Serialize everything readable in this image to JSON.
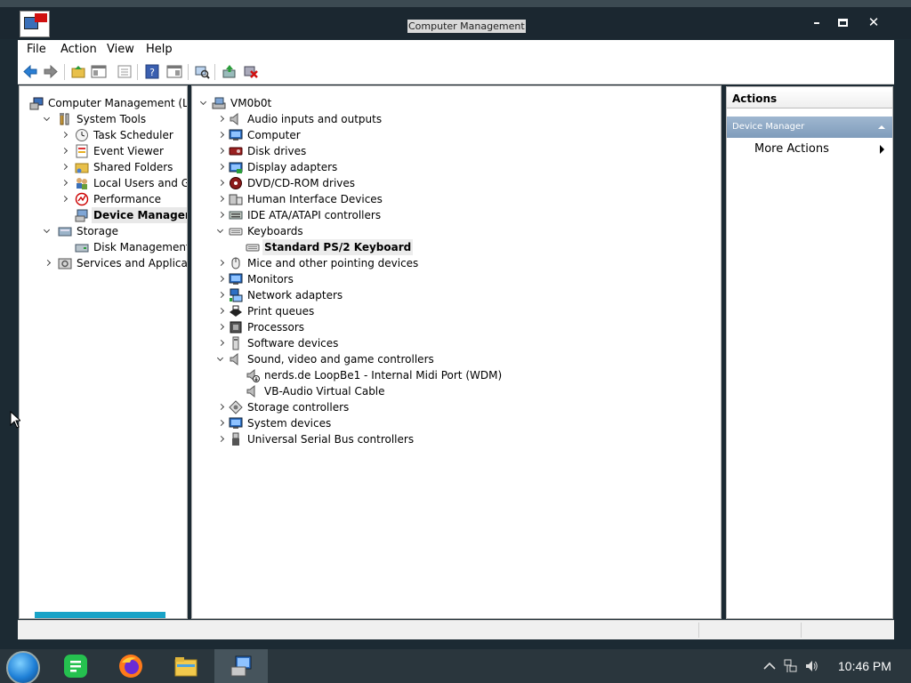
{
  "window": {
    "title": "Computer Management"
  },
  "menu": [
    "File",
    "Action",
    "View",
    "Help"
  ],
  "tree": [
    {
      "label": "Computer Management (Local)",
      "icon": "computer-management-icon",
      "exp": ""
    },
    {
      "label": "System Tools",
      "icon": "tools-icon",
      "exp": "o"
    },
    {
      "label": "Task Scheduler",
      "icon": "clock-icon",
      "exp": "c"
    },
    {
      "label": "Event Viewer",
      "icon": "event-viewer-icon",
      "exp": "c"
    },
    {
      "label": "Shared Folders",
      "icon": "shared-folder-icon",
      "exp": "c"
    },
    {
      "label": "Local Users and Groups",
      "icon": "users-icon",
      "exp": "c"
    },
    {
      "label": "Performance",
      "icon": "performance-icon",
      "exp": "c"
    },
    {
      "label": "Device Manager",
      "icon": "device-manager-icon",
      "exp": "",
      "selected": true
    },
    {
      "label": "Storage",
      "icon": "storage-icon",
      "exp": "o"
    },
    {
      "label": "Disk Management",
      "icon": "disk-management-icon",
      "exp": ""
    },
    {
      "label": "Services and Applications",
      "icon": "services-icon",
      "exp": "c"
    }
  ],
  "devices": [
    {
      "label": "VM0b0t",
      "icon": "computer-icon",
      "exp": "o"
    },
    {
      "label": "Audio inputs and outputs",
      "icon": "speaker-icon",
      "exp": "c"
    },
    {
      "label": "Computer",
      "icon": "monitor-icon",
      "exp": "c"
    },
    {
      "label": "Disk drives",
      "icon": "disk-drive-icon",
      "exp": "c"
    },
    {
      "label": "Display adapters",
      "icon": "display-adapter-icon",
      "exp": "c"
    },
    {
      "label": "DVD/CD-ROM drives",
      "icon": "dvd-icon",
      "exp": "c"
    },
    {
      "label": "Human Interface Devices",
      "icon": "hid-icon",
      "exp": "c"
    },
    {
      "label": "IDE ATA/ATAPI controllers",
      "icon": "ide-icon",
      "exp": "c"
    },
    {
      "label": "Keyboards",
      "icon": "keyboard-icon",
      "exp": "o"
    },
    {
      "label": "Standard PS/2 Keyboard",
      "icon": "keyboard-icon",
      "exp": "",
      "child": true,
      "selected": true
    },
    {
      "label": "Mice and other pointing devices",
      "icon": "mouse-icon",
      "exp": "c"
    },
    {
      "label": "Monitors",
      "icon": "monitor-icon",
      "exp": "c"
    },
    {
      "label": "Network adapters",
      "icon": "network-icon",
      "exp": "c"
    },
    {
      "label": "Print queues",
      "icon": "printer-icon",
      "exp": "c"
    },
    {
      "label": "Processors",
      "icon": "processor-icon",
      "exp": "c"
    },
    {
      "label": "Software devices",
      "icon": "software-device-icon",
      "exp": "c"
    },
    {
      "label": "Sound, video and game controllers",
      "icon": "speaker-icon",
      "exp": "o"
    },
    {
      "label": "nerds.de LoopBe1 - Internal Midi Port (WDM)",
      "icon": "speaker-download-icon",
      "exp": "",
      "child": true
    },
    {
      "label": "VB-Audio Virtual Cable",
      "icon": "speaker-icon",
      "exp": "",
      "child": true
    },
    {
      "label": "Storage controllers",
      "icon": "storage-controller-icon",
      "exp": "c"
    },
    {
      "label": "System devices",
      "icon": "monitor-icon",
      "exp": "c"
    },
    {
      "label": "Universal Serial Bus controllers",
      "icon": "usb-icon",
      "exp": "c"
    }
  ],
  "actions": {
    "header": "Actions",
    "section": "Device Manager",
    "more": "More Actions"
  },
  "taskbar": {
    "clock": "10:46 PM"
  }
}
